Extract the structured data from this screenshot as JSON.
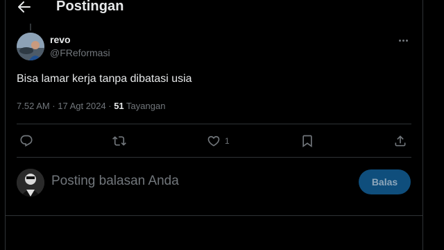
{
  "header": {
    "title": "Postingan"
  },
  "post": {
    "author_name": "revo",
    "author_handle": "@FReformasi",
    "text": "Bisa lamar kerja tanpa dibatasi usia",
    "time": "7.52 AM · 17 Agt 2024 · ",
    "views_count": "51",
    "views_label": " Tayangan"
  },
  "actions": {
    "reply_icon": "reply-icon",
    "retweet_icon": "retweet-icon",
    "like_icon": "heart-icon",
    "like_count": "1",
    "bookmark_icon": "bookmark-icon",
    "share_icon": "share-icon"
  },
  "reply": {
    "placeholder": "Posting balasan Anda",
    "button_label": "Balas"
  },
  "colors": {
    "background": "#000000",
    "text_primary": "#e7e9ea",
    "text_secondary": "#71767b",
    "divider": "#2f3336",
    "reply_button_bg": "#0f4e7c"
  }
}
